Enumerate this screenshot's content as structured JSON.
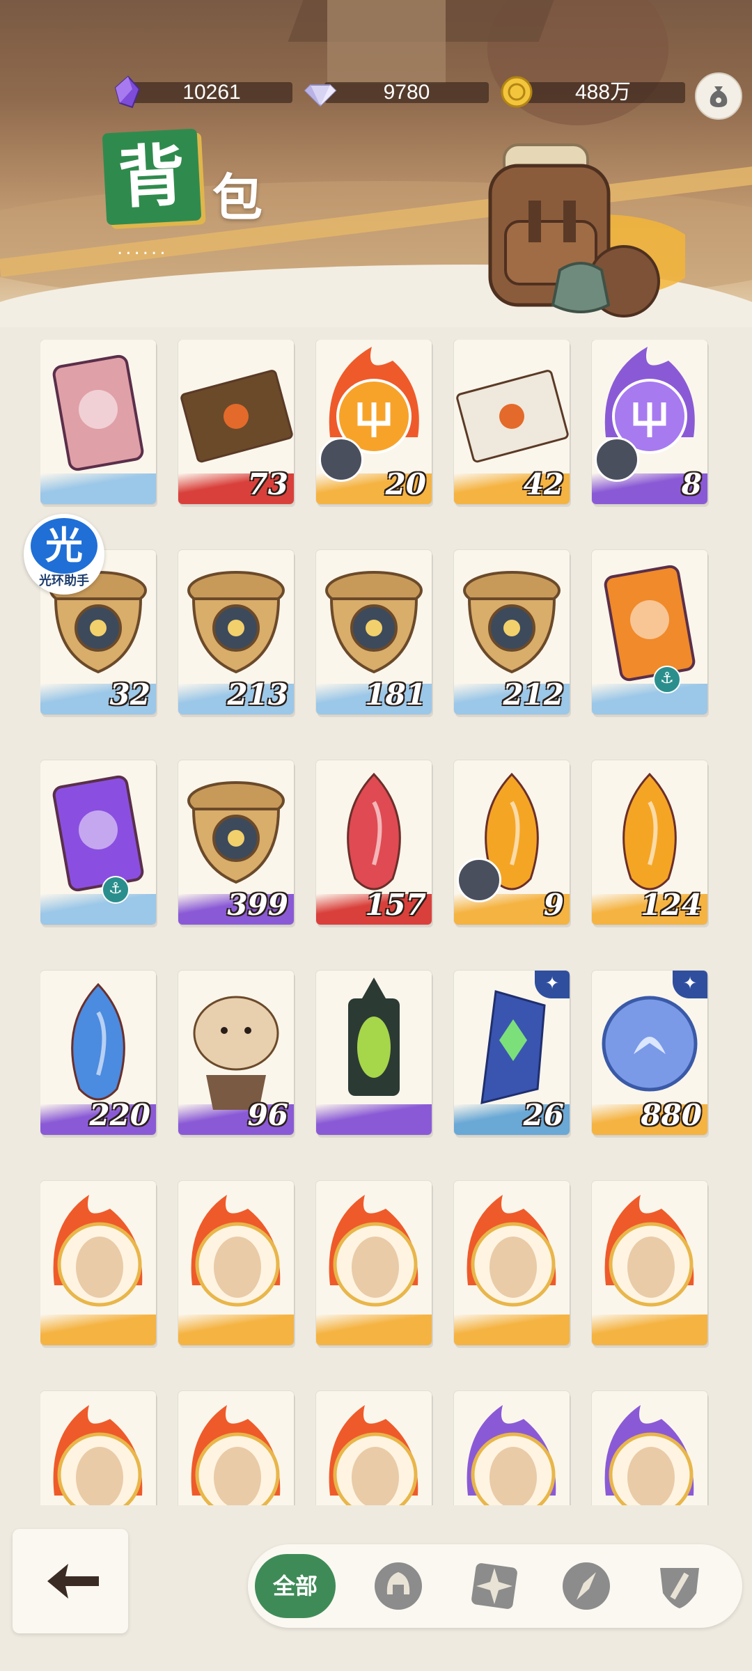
{
  "currencies": [
    {
      "icon": "purple-crystal-icon",
      "value": "10261"
    },
    {
      "icon": "diamond-icon",
      "value": "9780"
    },
    {
      "icon": "gold-coin-icon",
      "value": "488万"
    }
  ],
  "title": {
    "badge": "背",
    "rest": "包",
    "dots": "......"
  },
  "helper": {
    "glyph": "光",
    "label": "光环助手"
  },
  "items": [
    [
      {
        "icon": "ticket-icon",
        "count": "",
        "floor": "#9bc7e8"
      },
      {
        "icon": "envelope-rose-icon",
        "count": "73",
        "floor": "#d9403b"
      },
      {
        "icon": "fire-trident-icon",
        "count": "20",
        "floor": "#f5b342",
        "puzzle": true
      },
      {
        "icon": "letter-seal-icon",
        "count": "42",
        "floor": "#f5b342"
      },
      {
        "icon": "purple-trident-icon",
        "count": "8",
        "floor": "#8a5ad6",
        "puzzle": true
      }
    ],
    [
      {
        "icon": "acorn-eye-icon",
        "count": "32",
        "floor": "#9bc7e8"
      },
      {
        "icon": "acorn-sun-icon",
        "count": "213",
        "floor": "#9bc7e8"
      },
      {
        "icon": "acorn-leaf-icon",
        "count": "181",
        "floor": "#9bc7e8"
      },
      {
        "icon": "acorn-star-icon",
        "count": "212",
        "floor": "#9bc7e8"
      },
      {
        "icon": "orange-ticket-icon",
        "count": "",
        "floor": "#9bc7e8",
        "anchor": true
      }
    ],
    [
      {
        "icon": "purple-ticket-icon",
        "count": "",
        "floor": "#9bc7e8",
        "anchor": true
      },
      {
        "icon": "acorn-diamond-icon",
        "count": "399",
        "floor": "#8a5ad6"
      },
      {
        "icon": "red-crystal-icon",
        "count": "157",
        "floor": "#d9403b"
      },
      {
        "icon": "gold-crystal-icon",
        "count": "9",
        "floor": "#f5b342",
        "puzzle": true
      },
      {
        "icon": "gold-crystal-icon",
        "count": "124",
        "floor": "#f5b342"
      }
    ],
    [
      {
        "icon": "blue-crystal-icon",
        "count": "220",
        "floor": "#8a5ad6"
      },
      {
        "icon": "hamster-figure-icon",
        "count": "96",
        "floor": "#8a5ad6"
      },
      {
        "icon": "lantern-icon",
        "count": "",
        "floor": "#8a5ad6"
      },
      {
        "icon": "rune-stone-icon",
        "count": "26",
        "floor": "#6aa8d6",
        "star": true
      },
      {
        "icon": "whale-coin-icon",
        "count": "880",
        "floor": "#f5b342",
        "star": true
      }
    ],
    [
      {
        "icon": "fire-portrait-icon",
        "count": "",
        "floor": "#f5b342"
      },
      {
        "icon": "fire-portrait-icon",
        "count": "",
        "floor": "#f5b342"
      },
      {
        "icon": "fire-portrait-icon",
        "count": "",
        "floor": "#f5b342"
      },
      {
        "icon": "fire-portrait-icon",
        "count": "",
        "floor": "#f5b342"
      },
      {
        "icon": "fire-portrait-icon",
        "count": "",
        "floor": "#f5b342"
      }
    ],
    [
      {
        "icon": "fire-portrait-icon",
        "count": "",
        "floor": "#f5b342"
      },
      {
        "icon": "fire-portrait-icon",
        "count": "",
        "floor": "#f5b342"
      },
      {
        "icon": "fire-portrait-icon",
        "count": "",
        "floor": "#f5b342"
      },
      {
        "icon": "purple-portrait-icon",
        "count": "",
        "floor": "#8a5ad6"
      },
      {
        "icon": "purple-portrait-icon",
        "count": "",
        "floor": "#8a5ad6"
      }
    ]
  ],
  "filters": {
    "all_label": "全部",
    "icons": [
      "spartan-helmet-icon",
      "compass-rose-icon",
      "compass-needle-icon",
      "sword-shield-icon"
    ]
  }
}
